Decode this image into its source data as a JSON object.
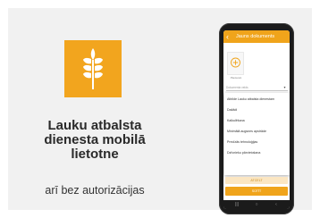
{
  "promo": {
    "headline": "Lauku atbalsta dienesta mobilā lietotne",
    "subline": "arī bez autorizācijas",
    "logo_icon": "wheat-icon",
    "logo_color": "#f2a51e"
  },
  "phone_screen": {
    "app_bar": {
      "back_icon": "‹",
      "title": "Jauns dokuments"
    },
    "field_caption": "",
    "photo_add_caption": "Pievienot",
    "type_select": {
      "value": "Dokumenta veids",
      "caret": "▾"
    },
    "dropdown_items": [
      "Atbilde Lauku atbalsta dienestam",
      "Dažādi",
      "Kalkulēšana",
      "Minimālā augsnes apstrāde",
      "Precīzās tehnoloģijas",
      "Dzīvnieku pārvietošana"
    ],
    "cancel_label": "ATCELT",
    "submit_label": "SŪTĪT",
    "nav": {
      "menu_glyph": "|||",
      "home_glyph": "○",
      "back_glyph": "‹"
    },
    "accent_color": "#f0a41b"
  }
}
